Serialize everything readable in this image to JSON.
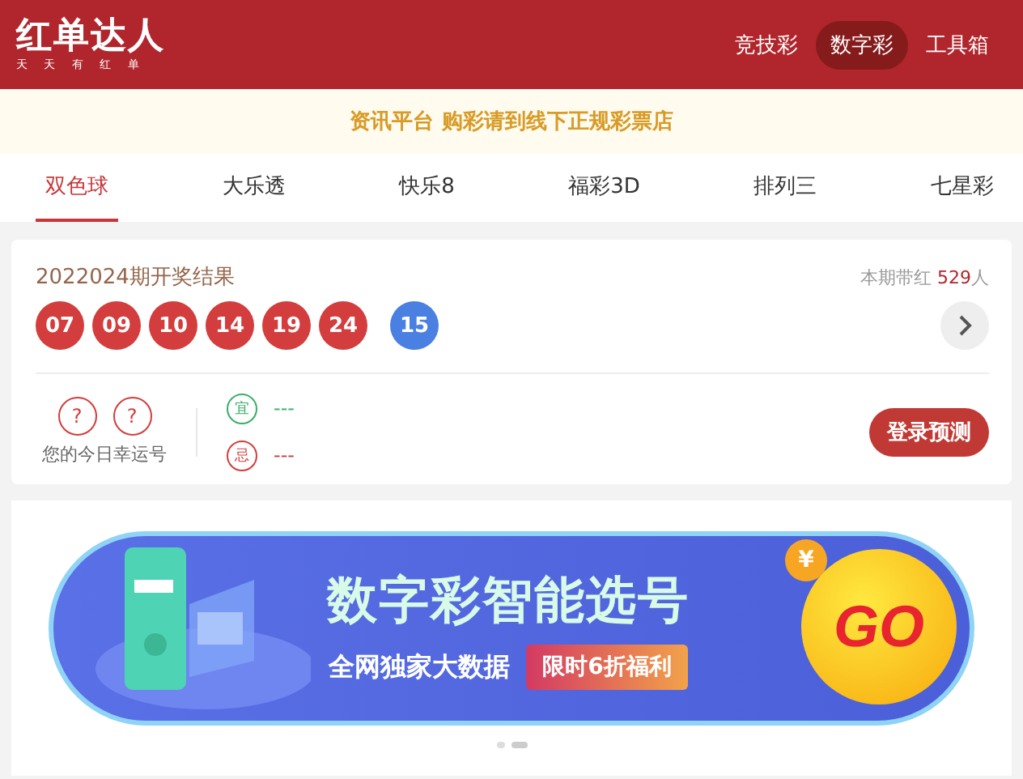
{
  "header": {
    "logo": "红单达人",
    "slogan": "天 天 有 红 单",
    "nav": [
      {
        "label": "竞技彩",
        "selected": false
      },
      {
        "label": "数字彩",
        "selected": true
      },
      {
        "label": "工具箱",
        "selected": false
      }
    ]
  },
  "notice": "资讯平台 购彩请到线下正规彩票店",
  "tabs": [
    {
      "label": "双色球",
      "selected": true
    },
    {
      "label": "大乐透",
      "selected": false
    },
    {
      "label": "快乐8",
      "selected": false
    },
    {
      "label": "福彩3D",
      "selected": false
    },
    {
      "label": "排列三",
      "selected": false
    },
    {
      "label": "七星彩",
      "selected": false
    }
  ],
  "result": {
    "title": "2022024期开奖结果",
    "hot_label": "本期带红",
    "hot_count": "529",
    "hot_unit": "人",
    "balls": [
      {
        "number": "07",
        "kind": "red"
      },
      {
        "number": "09",
        "kind": "red"
      },
      {
        "number": "10",
        "kind": "red"
      },
      {
        "number": "14",
        "kind": "red"
      },
      {
        "number": "19",
        "kind": "red"
      },
      {
        "number": "24",
        "kind": "red"
      },
      {
        "number": "15",
        "kind": "blue"
      }
    ],
    "lucky": {
      "numbers": [
        "?",
        "?"
      ],
      "caption": "您的今日幸运号"
    },
    "advice": [
      {
        "kind": "good",
        "badge": "宜",
        "text": "---"
      },
      {
        "kind": "bad",
        "badge": "忌",
        "text": "---"
      }
    ],
    "login_button": "登录预测"
  },
  "banner": {
    "headline": "数字彩智能选号",
    "subline": "全网独家大数据",
    "promo": "限时6折福利",
    "go": "GO",
    "coin": "¥",
    "dots": [
      {
        "selected": false
      },
      {
        "selected": true
      }
    ]
  }
}
